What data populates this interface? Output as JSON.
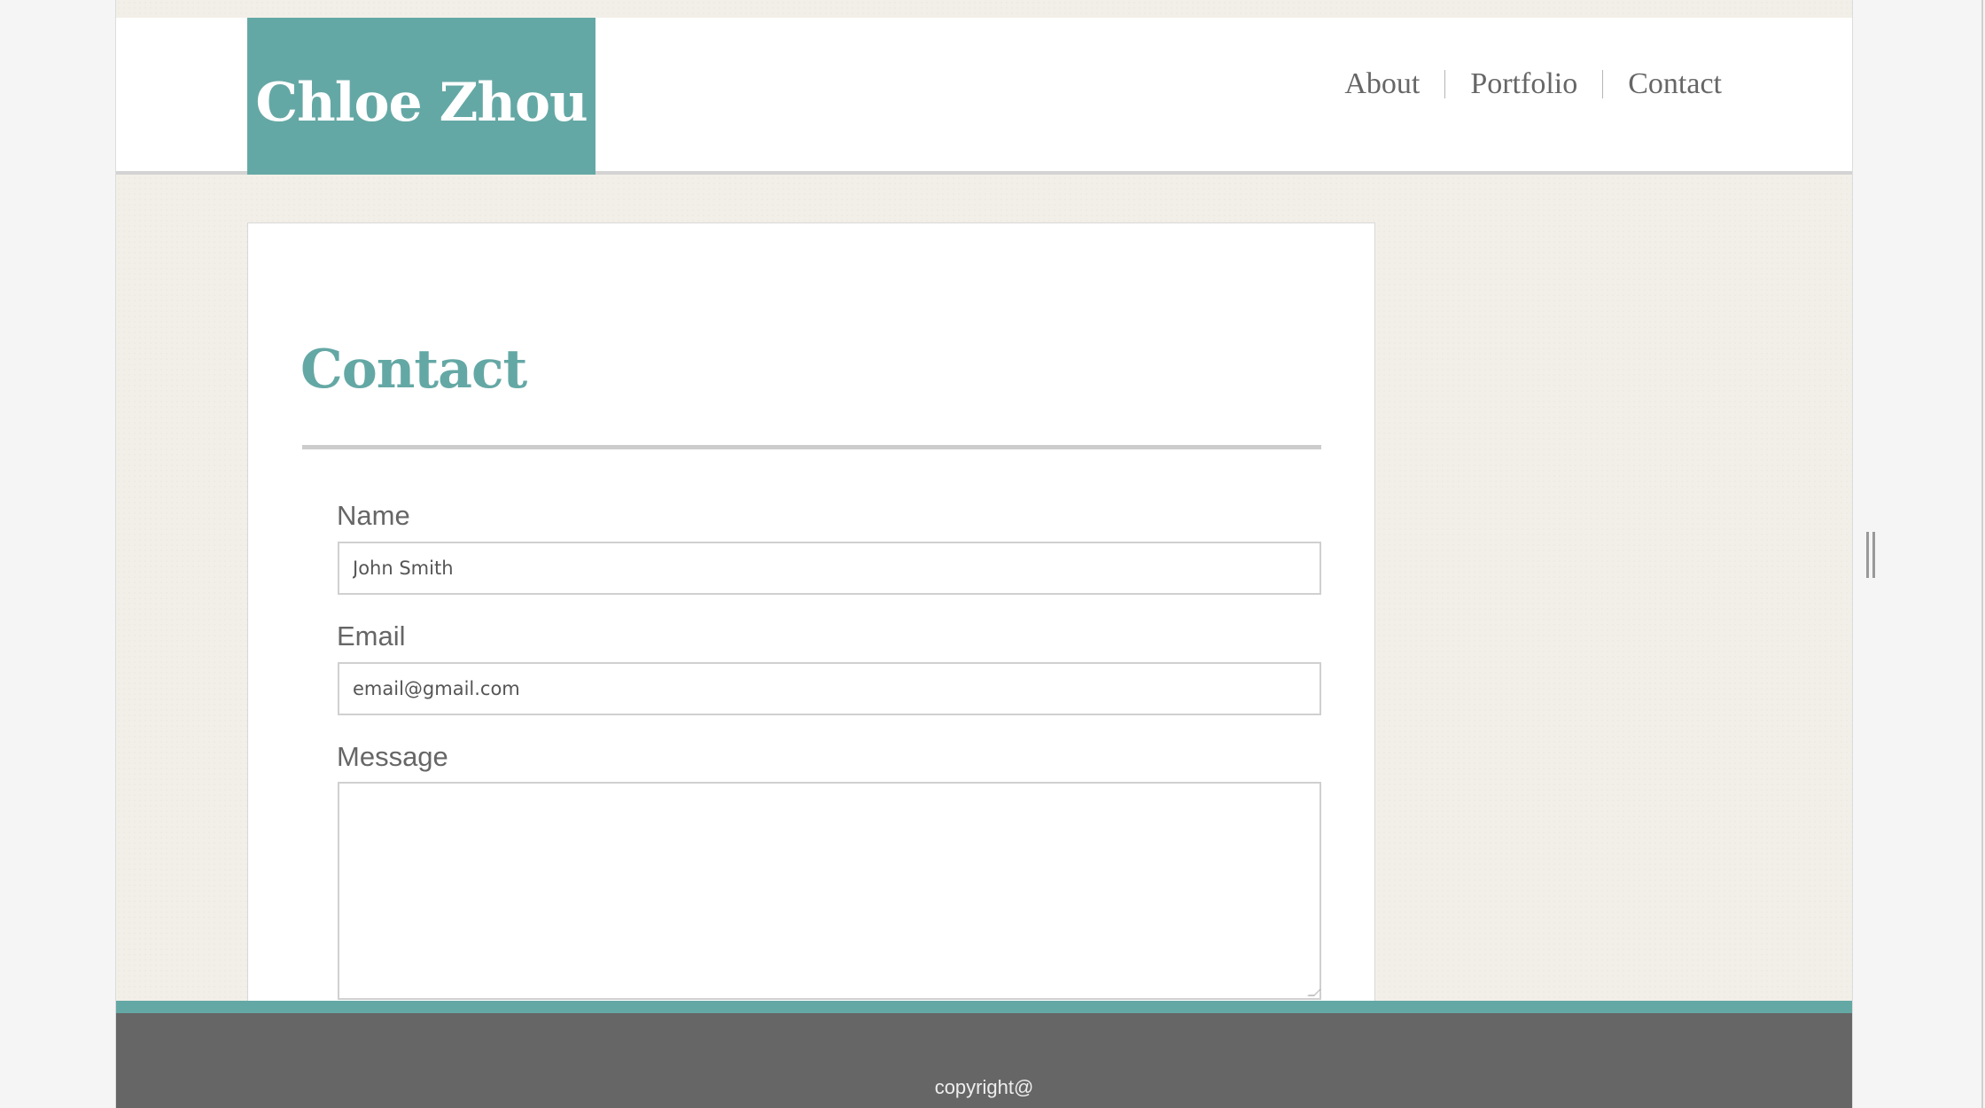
{
  "site": {
    "brand": "Chloe Zhou"
  },
  "nav": {
    "items": [
      "About",
      "Portfolio",
      "Contact"
    ]
  },
  "main": {
    "title": "Contact",
    "form": {
      "name_label": "Name",
      "name_value": "John Smith",
      "email_label": "Email",
      "email_value": "email@gmail.com",
      "message_label": "Message",
      "message_value": ""
    }
  },
  "footer": {
    "text": "copyright@"
  },
  "colors": {
    "accent": "#64a8a5",
    "footer_bg": "#666666",
    "page_bg": "#f2efe8"
  }
}
